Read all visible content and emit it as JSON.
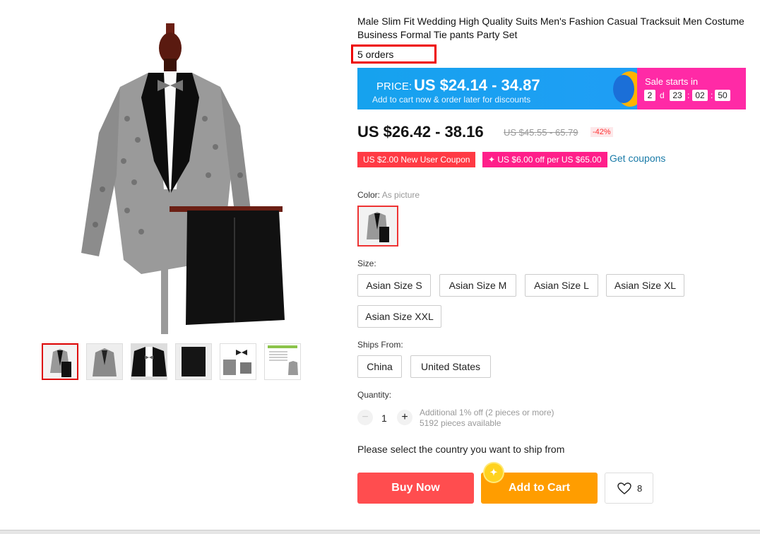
{
  "product": {
    "title": "Male Slim Fit Wedding High Quality Suits Men's Fashion Casual Tracksuit Men Costume Business Formal Tie pants Party Set",
    "orders": "5 orders"
  },
  "promo": {
    "price_label": "PRICE:",
    "price_value": "US $24.14 - 34.87",
    "note": "Add to cart now & order later for discounts",
    "sale_label": "Sale starts in",
    "countdown": {
      "days": "2",
      "d": "d",
      "hours": "23",
      "minutes": "02",
      "seconds": "50",
      "sep": ":"
    }
  },
  "pricing": {
    "current": "US $26.42 - 38.16",
    "original": "US $45.55 - 65.79",
    "discount": "-42%"
  },
  "coupons": {
    "new_user": "US $2.00 New User Coupon",
    "store": "✦ US $6.00 off per US $65.00",
    "get": "Get coupons"
  },
  "color": {
    "label": "Color:",
    "value": "As picture"
  },
  "size": {
    "label": "Size:",
    "options": [
      "Asian Size S",
      "Asian Size M",
      "Asian Size L",
      "Asian Size XL",
      "Asian Size XXL"
    ]
  },
  "ships_from": {
    "label": "Ships From:",
    "options": [
      "China",
      "United States"
    ]
  },
  "quantity": {
    "label": "Quantity:",
    "minus": "−",
    "value": "1",
    "plus": "+",
    "note1": "Additional 1% off (2 pieces or more)",
    "note2": "5192 pieces available"
  },
  "ship_message": "Please select the country you want to ship from",
  "actions": {
    "buy_now": "Buy Now",
    "add_to_cart": "Add to Cart",
    "wishlist_count": "8"
  },
  "colors": {
    "accent_red": "#ff4d4f",
    "accent_orange": "#ff9d00",
    "banner_blue": "#1f9ef5",
    "banner_pink": "#ff2aa6"
  }
}
